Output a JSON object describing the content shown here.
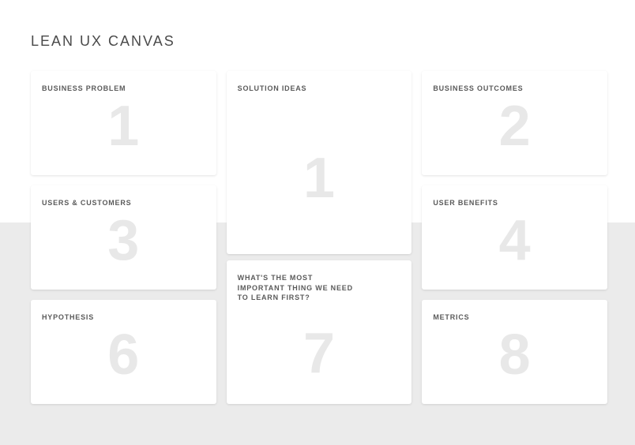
{
  "title": "LEAN UX CANVAS",
  "cards": {
    "business_problem": {
      "label": "BUSINESS PROBLEM",
      "number": "1"
    },
    "solution_ideas": {
      "label": "SOLUTION IDEAS",
      "number": "1"
    },
    "business_outcomes": {
      "label": "BUSINESS OUTCOMES",
      "number": "2"
    },
    "users_customers": {
      "label": "USERS & CUSTOMERS",
      "number": "3"
    },
    "user_benefits": {
      "label": "USER BENEFITS",
      "number": "4"
    },
    "hypothesis": {
      "label": "HYPOTHESIS",
      "number": "6"
    },
    "learn_first": {
      "label": "WHAT'S THE MOST IMPORTANT THING WE NEED TO LEARN FIRST?",
      "number": "7"
    },
    "metrics": {
      "label": "METRICS",
      "number": "8"
    }
  }
}
